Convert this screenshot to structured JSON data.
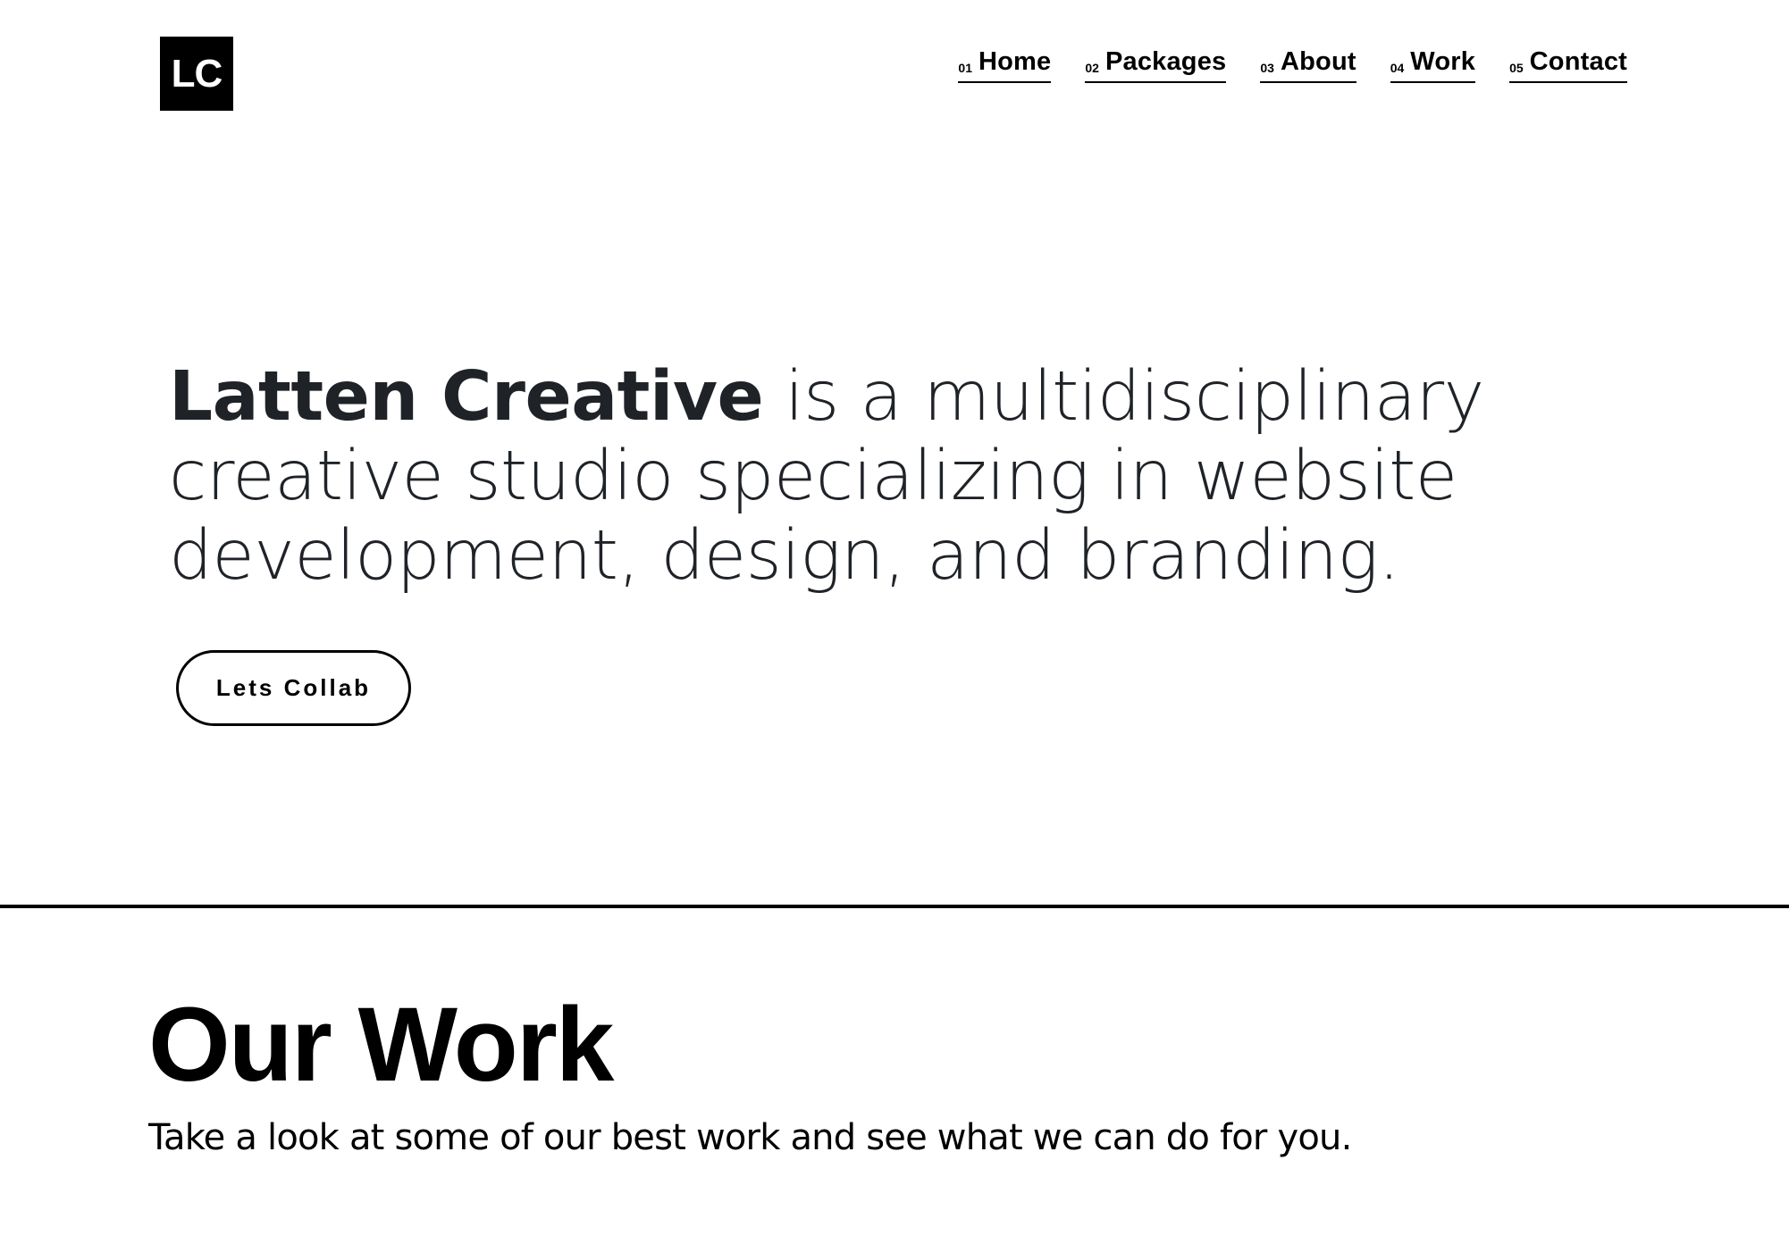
{
  "header": {
    "logo_text": "LC",
    "nav": [
      {
        "num": "01",
        "label": "Home"
      },
      {
        "num": "02",
        "label": "Packages"
      },
      {
        "num": "03",
        "label": "About"
      },
      {
        "num": "04",
        "label": "Work"
      },
      {
        "num": "05",
        "label": "Contact"
      }
    ]
  },
  "hero": {
    "brand": "Latten Creative",
    "tagline": " is a multidisciplinary creative studio specializing in website development, design, and branding.",
    "cta_label": "Lets Collab"
  },
  "work": {
    "title": "Our Work",
    "subtitle": "Take a look at some of our best work and see what we can do for you."
  },
  "colors": {
    "background": "#ffffff",
    "text": "#000000",
    "hero_text": "#1f2328"
  }
}
